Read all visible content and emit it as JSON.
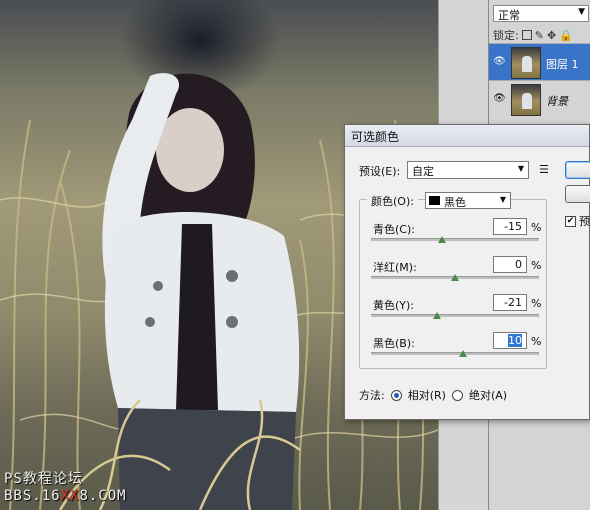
{
  "watermark": {
    "line1": "PS教程论坛",
    "line2_a": "BBS.16",
    "line2_b": "XX",
    "line2_c": "8.COM"
  },
  "layers_panel": {
    "blend_mode": "正常",
    "lock_label": "锁定:",
    "layers": [
      {
        "name": "图层 1",
        "selected": true
      },
      {
        "name": "背景",
        "selected": false
      }
    ]
  },
  "dialog": {
    "title": "可选颜色",
    "preset_label": "预设(E):",
    "preset_value": "自定",
    "colors_label": "颜色(O):",
    "colors_value": "黑色",
    "sliders": [
      {
        "label": "青色(C):",
        "value": "-15",
        "level": -15
      },
      {
        "label": "洋红(M):",
        "value": "0",
        "level": 0
      },
      {
        "label": "黄色(Y):",
        "value": "-21",
        "level": -21
      },
      {
        "label": "黑色(B):",
        "value": "10",
        "level": 10
      }
    ],
    "percent": "%",
    "preview_label": "预",
    "method_label": "方法:",
    "relative_label": "相对(R)",
    "absolute_label": "绝对(A)",
    "method_selected": "relative"
  }
}
